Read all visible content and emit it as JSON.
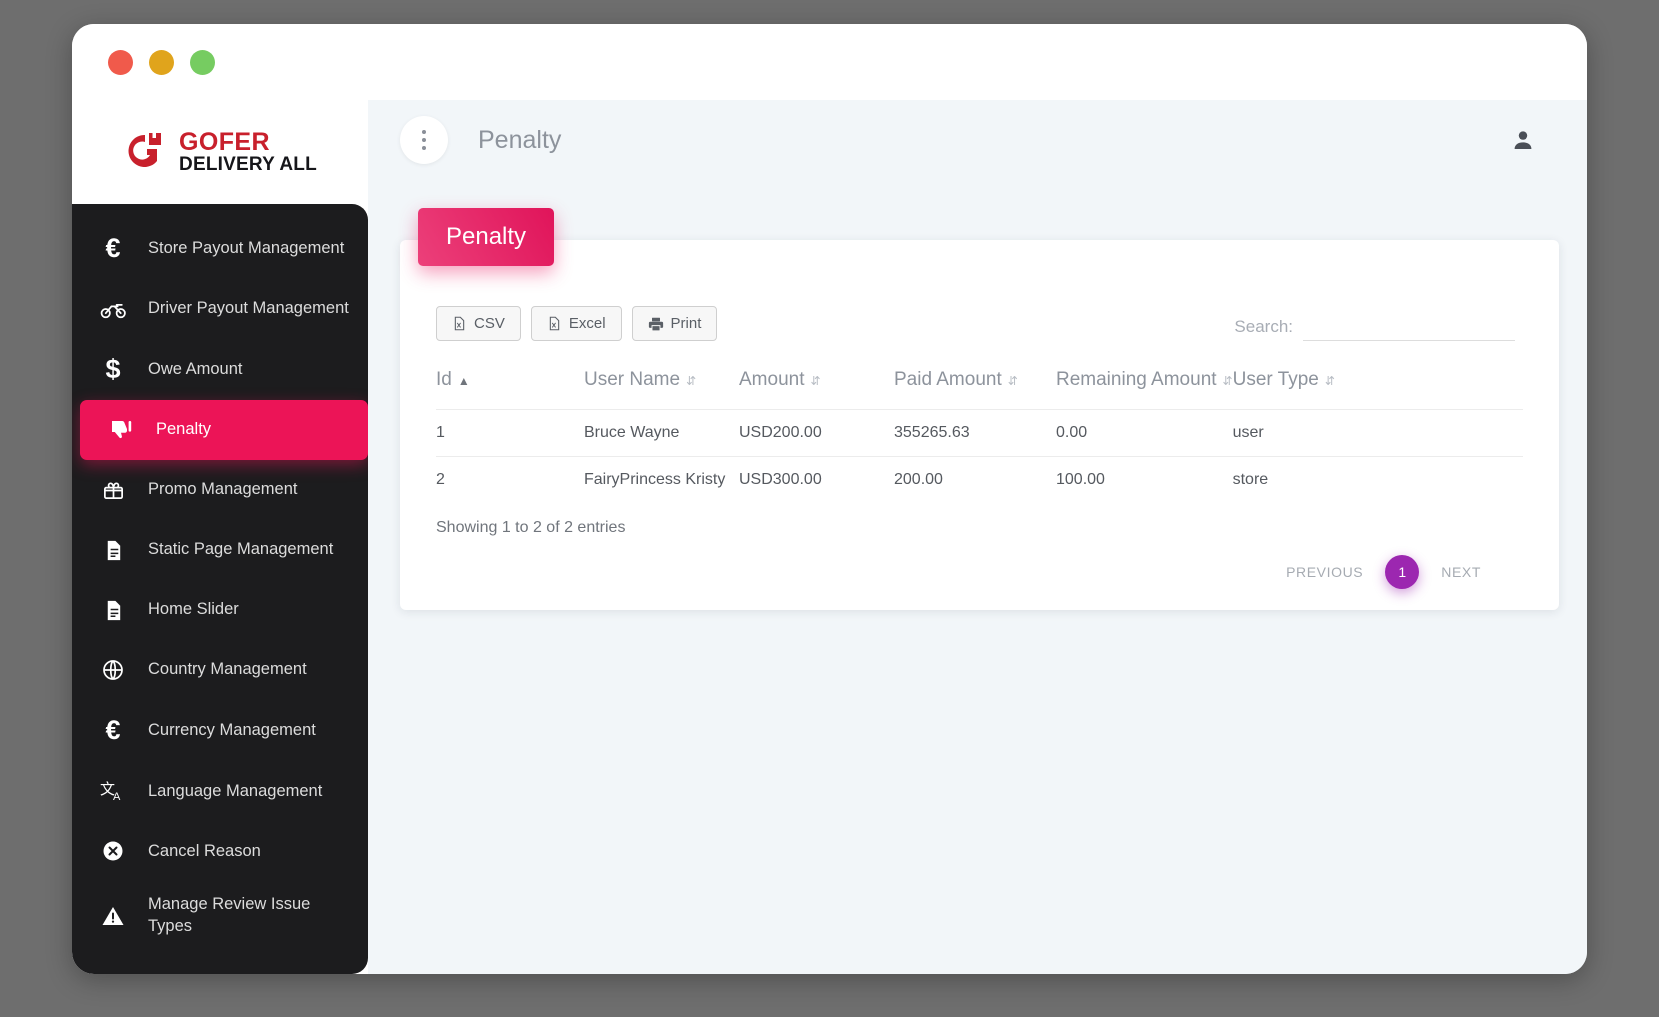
{
  "window": {
    "traffic_lights": [
      "close",
      "minimize",
      "maximize"
    ]
  },
  "brand": {
    "name_top": "GOFER",
    "name_bottom": "DELIVERY ALL",
    "logo_color": "#c8202c"
  },
  "sidebar": {
    "items": [
      {
        "label": "Store Payout Management",
        "icon": "euro-icon",
        "active": false
      },
      {
        "label": "Driver Payout Management",
        "icon": "motorbike-icon",
        "active": false
      },
      {
        "label": "Owe Amount",
        "icon": "dollar-icon",
        "active": false
      },
      {
        "label": "Penalty",
        "icon": "thumbs-down-icon",
        "active": true
      },
      {
        "label": "Promo Management",
        "icon": "gift-icon",
        "active": false
      },
      {
        "label": "Static Page Management",
        "icon": "document-icon",
        "active": false
      },
      {
        "label": "Home Slider",
        "icon": "document-icon",
        "active": false
      },
      {
        "label": "Country Management",
        "icon": "globe-icon",
        "active": false
      },
      {
        "label": "Currency Management",
        "icon": "euro-icon",
        "active": false
      },
      {
        "label": "Language Management",
        "icon": "translate-icon",
        "active": false
      },
      {
        "label": "Cancel Reason",
        "icon": "circle-x-icon",
        "active": false
      },
      {
        "label": "Manage Review Issue Types",
        "icon": "warning-triangle-icon",
        "active": false
      }
    ],
    "active_color": "#ec1457"
  },
  "topbar": {
    "menu_icon": "kebab-menu-icon",
    "title": "Penalty",
    "account_icon": "user-icon"
  },
  "card": {
    "badge": "Penalty",
    "badge_color": "#ea1a5c",
    "export_buttons": [
      {
        "label": "CSV",
        "icon": "csv-file-icon"
      },
      {
        "label": "Excel",
        "icon": "excel-file-icon"
      },
      {
        "label": "Print",
        "icon": "printer-icon"
      }
    ],
    "search": {
      "label": "Search:",
      "value": "",
      "placeholder": ""
    },
    "table": {
      "columns": [
        {
          "label": "Id",
          "sort": "asc"
        },
        {
          "label": "User Name",
          "sort": "none"
        },
        {
          "label": "Amount",
          "sort": "none"
        },
        {
          "label": "Paid Amount",
          "sort": "none"
        },
        {
          "label": "Remaining Amount",
          "sort": "none"
        },
        {
          "label": "User Type",
          "sort": "none"
        }
      ],
      "rows": [
        {
          "id": "1",
          "user_name": "Bruce Wayne",
          "amount": "USD200.00",
          "paid_amount": "355265.63",
          "remaining_amount": "0.00",
          "user_type": "user"
        },
        {
          "id": "2",
          "user_name": "FairyPrincess Kristy",
          "amount": "USD300.00",
          "paid_amount": "200.00",
          "remaining_amount": "100.00",
          "user_type": "store"
        }
      ]
    },
    "showing": "Showing 1 to 2 of 2 entries",
    "pagination": {
      "previous": "PREVIOUS",
      "current_page": "1",
      "next": "NEXT",
      "accent_color": "#9c27b0"
    }
  }
}
